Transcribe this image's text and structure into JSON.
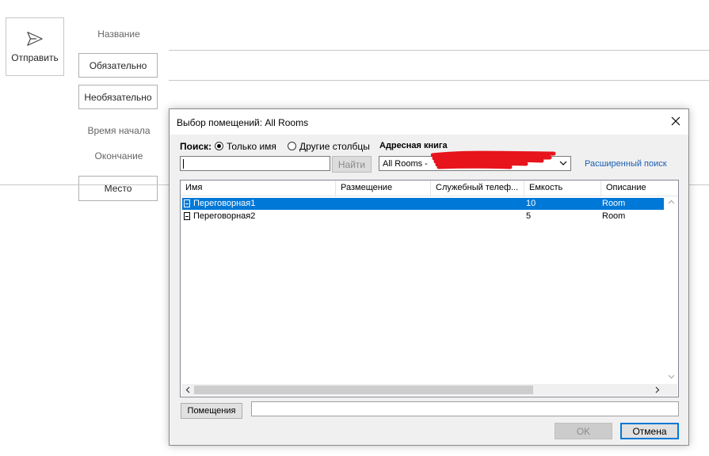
{
  "form": {
    "send_label": "Отправить",
    "title_label": "Название",
    "required_label": "Обязательно",
    "optional_label": "Необязательно",
    "start_time_label": "Время начала",
    "end_time_label": "Окончание",
    "location_label": "Место"
  },
  "dialog": {
    "title": "Выбор помещений: All Rooms",
    "search_label": "Поиск:",
    "radio_name_only": "Только имя",
    "radio_other_columns": "Другие столбцы",
    "address_book_label": "Адресная книга",
    "find_button": "Найти",
    "search_value": "",
    "address_book_value": "All Rooms - ",
    "advanced_search_link": "Расширенный поиск",
    "columns": [
      "Имя",
      "Размещение",
      "Служебный телеф...",
      "Емкость",
      "Описание"
    ],
    "rows": [
      {
        "name": "Переговорная1",
        "location": "",
        "phone": "",
        "capacity": "10",
        "description": "Room",
        "selected": true
      },
      {
        "name": "Переговорная2",
        "location": "",
        "phone": "",
        "capacity": "5",
        "description": "Room",
        "selected": false
      }
    ],
    "rooms_button": "Помещения",
    "rooms_value": "",
    "ok_button": "OK",
    "cancel_button": "Отмена"
  },
  "colors": {
    "selection": "#0078d7",
    "link": "#1a5fb4",
    "redaction": "#e8141c"
  },
  "icons": {
    "send": "send-icon",
    "close": "close-icon",
    "dropdown": "chevron-down-icon",
    "room": "room-icon"
  }
}
